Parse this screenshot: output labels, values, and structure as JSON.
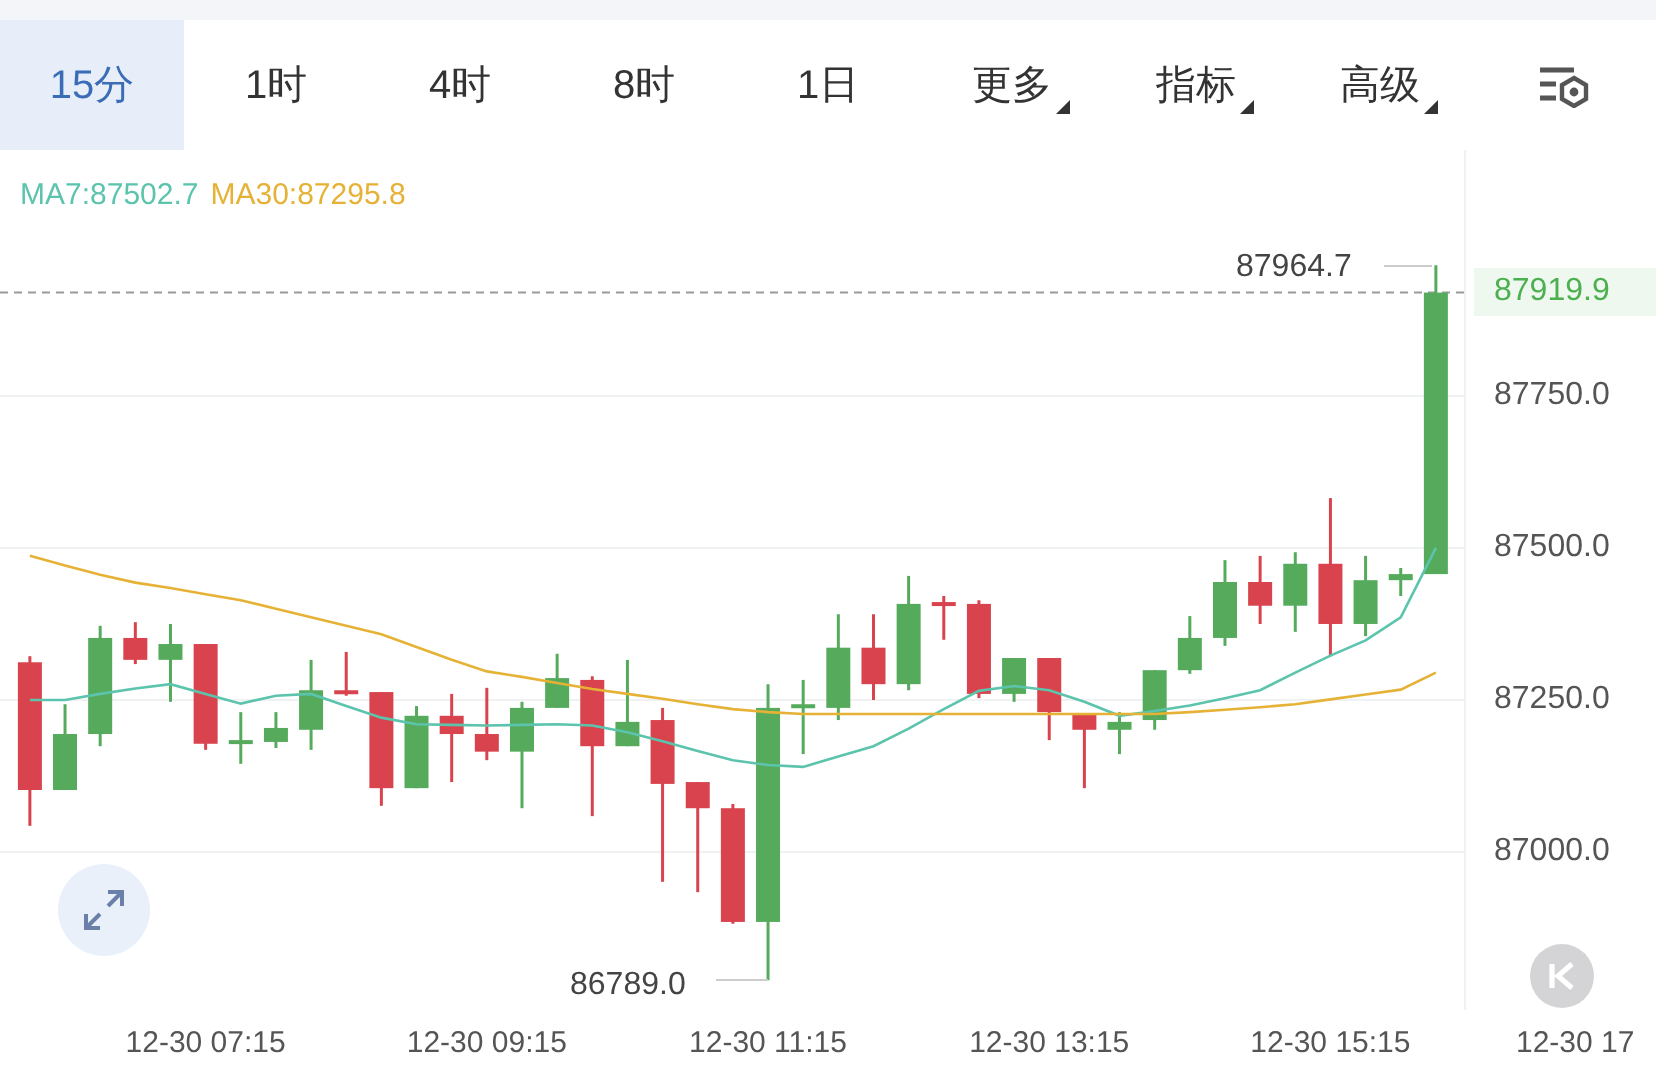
{
  "tabs": [
    {
      "label": "15分",
      "selected": true,
      "dropdown": false
    },
    {
      "label": "1时",
      "selected": false,
      "dropdown": false
    },
    {
      "label": "4时",
      "selected": false,
      "dropdown": false
    },
    {
      "label": "8时",
      "selected": false,
      "dropdown": false
    },
    {
      "label": "1日",
      "selected": false,
      "dropdown": false
    },
    {
      "label": "更多",
      "selected": false,
      "dropdown": true
    },
    {
      "label": "指标",
      "selected": false,
      "dropdown": true
    },
    {
      "label": "高级",
      "selected": false,
      "dropdown": true
    }
  ],
  "high_label": "87964.7",
  "low_label": "86789.0",
  "chart_data": {
    "type": "candlestick",
    "categories": [
      null,
      null,
      null,
      null,
      null,
      "12-30 07:15",
      null,
      null,
      null,
      null,
      null,
      null,
      null,
      "12-30 09:15",
      null,
      null,
      null,
      null,
      null,
      null,
      null,
      "12-30 11:15",
      null,
      null,
      null,
      null,
      null,
      null,
      null,
      "12-30 13:15",
      null,
      null,
      null,
      null,
      null,
      null,
      null,
      "12-30 15:15",
      null,
      null,
      null
    ],
    "ylim": [
      86740.2,
      88154.4
    ],
    "grid": true,
    "ref_lines": [
      {
        "axis": "y",
        "value": 87919.9,
        "label": "87919.9"
      }
    ],
    "ohlc": [
      [
        87312,
        87322,
        87043,
        87102
      ],
      [
        87102,
        87243,
        87102,
        87194
      ],
      [
        87194,
        87372,
        87174,
        87352
      ],
      [
        87352,
        87378,
        87309,
        87316
      ],
      [
        87316,
        87375,
        87247,
        87342
      ],
      [
        87342,
        87342,
        87168,
        87178
      ],
      [
        87178,
        87230,
        87145,
        87184
      ],
      [
        87181,
        87230,
        87171,
        87204
      ],
      [
        87201,
        87316,
        87168,
        87266
      ],
      [
        87266,
        87329,
        87257,
        87260
      ],
      [
        87263,
        87263,
        87076,
        87105
      ],
      [
        87105,
        87240,
        87105,
        87224
      ],
      [
        87224,
        87260,
        87115,
        87194
      ],
      [
        87194,
        87270,
        87151,
        87165
      ],
      [
        87165,
        87247,
        87072,
        87237
      ],
      [
        87237,
        87326,
        87237,
        87286
      ],
      [
        87283,
        87289,
        87059,
        87174
      ],
      [
        87174,
        87316,
        87174,
        87214
      ],
      [
        87217,
        87237,
        86951,
        87112
      ],
      [
        87115,
        87115,
        86934,
        87072
      ],
      [
        87072,
        87079,
        86882,
        86885
      ],
      [
        86885,
        87276,
        86789,
        87237
      ],
      [
        87237,
        87283,
        87161,
        87243
      ],
      [
        87237,
        87391,
        87217,
        87336
      ],
      [
        87336,
        87391,
        87250,
        87276
      ],
      [
        87276,
        87454,
        87266,
        87408
      ],
      [
        87411,
        87421,
        87349,
        87405
      ],
      [
        87408,
        87414,
        87253,
        87260
      ],
      [
        87260,
        87319,
        87247,
        87319
      ],
      [
        87319,
        87319,
        87184,
        87230
      ],
      [
        87227,
        87227,
        87105,
        87201
      ],
      [
        87201,
        87230,
        87161,
        87214
      ],
      [
        87217,
        87299,
        87201,
        87299
      ],
      [
        87299,
        87388,
        87293,
        87352
      ],
      [
        87352,
        87480,
        87339,
        87444
      ],
      [
        87444,
        87487,
        87375,
        87405
      ],
      [
        87405,
        87493,
        87362,
        87474
      ],
      [
        87474,
        87582,
        87322,
        87375
      ],
      [
        87375,
        87487,
        87355,
        87447
      ],
      [
        87447,
        87467,
        87421,
        87457
      ],
      [
        87457,
        87964.7,
        87457,
        87919.9
      ]
    ],
    "series": [
      {
        "name": "MA7:87502.7",
        "type": "line",
        "color": "#5cc4ad",
        "values": [
          87250,
          87250,
          87260,
          87269,
          87276,
          87260,
          87244,
          87257,
          87260,
          87240,
          87221,
          87210,
          87209,
          87208,
          87209,
          87210,
          87208,
          87197,
          87182,
          87166,
          87151,
          87143,
          87140,
          87157,
          87174,
          87203,
          87235,
          87265,
          87273,
          87266,
          87247,
          87224,
          87232,
          87241,
          87253,
          87266,
          87295,
          87323,
          87348,
          87386,
          87500
        ]
      },
      {
        "name": "MA30:87295.8",
        "type": "line",
        "color": "#e6b236",
        "values": [
          87487,
          87471,
          87456,
          87443,
          87434,
          87424,
          87414,
          87400,
          87386,
          87372,
          87358,
          87337,
          87316,
          87297,
          87288,
          87278,
          87268,
          87260,
          87252,
          87243,
          87235,
          87230,
          87227,
          87227,
          87227,
          87227,
          87227,
          87227,
          87227,
          87227,
          87227,
          87227,
          87227,
          87230,
          87234,
          87238,
          87243,
          87251,
          87259,
          87267,
          87295
        ]
      }
    ],
    "yticks": [
      {
        "value": 87750,
        "label": "87750.0"
      },
      {
        "value": 87500,
        "label": "87500.0"
      },
      {
        "value": 87250,
        "label": "87250.0"
      },
      {
        "value": 87000,
        "label": "87000.0"
      }
    ]
  },
  "cut_time_label": "12-30 17"
}
